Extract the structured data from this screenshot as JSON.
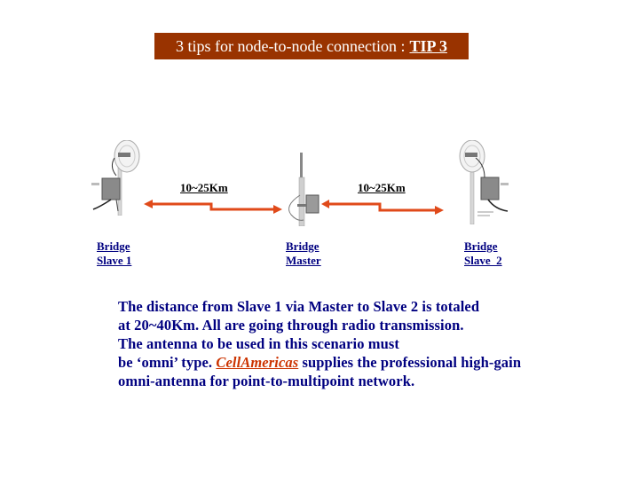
{
  "title": {
    "text": "3 tips for node-to-node connection :",
    "tip_label": "TIP 3",
    "background_color": "#993300"
  },
  "diagram": {
    "nodes": [
      {
        "id": "slave1",
        "line1": "Bridge",
        "line2": "Slave 1",
        "device": "dish-antenna-bridge"
      },
      {
        "id": "master",
        "line1": "Bridge",
        "line2": "Master",
        "device": "omni-antenna-bridge"
      },
      {
        "id": "slave2",
        "line1": "Bridge",
        "line2": "Slave  2",
        "device": "dish-antenna-bridge"
      }
    ],
    "links": [
      {
        "from": "slave1",
        "to": "master",
        "distance": "10~25Km"
      },
      {
        "from": "master",
        "to": "slave2",
        "distance": "10~25Km"
      }
    ],
    "arrow_color": "#e04a1a"
  },
  "description": {
    "line1": "The distance from Slave 1 via Master to Slave 2 is totaled",
    "line2": "at 20~40Km. All are going through radio transmission.",
    "line3": "The antenna to be used in this scenario must",
    "line4_pre": "be ‘omni’ type. ",
    "brand": "CellAmericas",
    "line4_post": " supplies the professional high-gain",
    "line5": "omni-antenna for point-to-multipoint network."
  }
}
